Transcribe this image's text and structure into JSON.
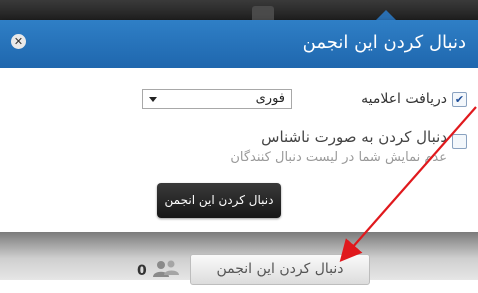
{
  "dialog": {
    "title": "دنبال کردن این انجمن",
    "close_icon": "close-icon",
    "notify_checked": true,
    "notify_label": "دریافت اعلامیه",
    "notify_select_value": "فوری",
    "anon_checked": false,
    "anon_label": "دنبال کردن به صورت ناشناس",
    "anon_description": "عدم نمایش شما در لیست دنبال کنندگان",
    "follow_button": "دنبال کردن این انجمن"
  },
  "page": {
    "follower_count": "0",
    "users_icon": "users-icon",
    "follow_button": "دنبال کردن این انجمن"
  },
  "annotation": {
    "color": "#e0191d"
  }
}
